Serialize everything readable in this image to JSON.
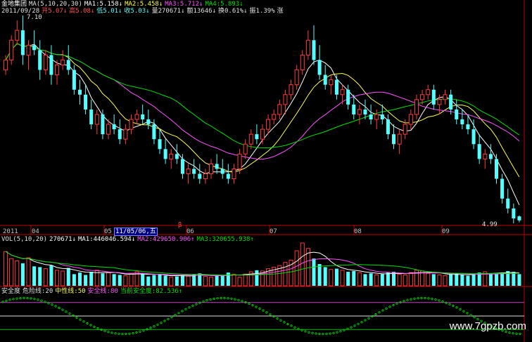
{
  "colors": {
    "up": "#ff3c3c",
    "down": "#54ffff",
    "ma1": "#ffffff",
    "ma2": "#ffff54",
    "ma3": "#ff54ff",
    "ma4": "#00e000",
    "grid": "#c00000",
    "safety_line": "#c040c0",
    "neutral_line": "#e0e0e0",
    "danger_line": "#00c000",
    "dot_curve": "#00e000"
  },
  "price_header": {
    "stock_name": "金地集团",
    "ma_label": "MA(5,10,20,30)",
    "ma1": "MA1:5.158↓",
    "ma2": "MA2:5.458↓",
    "ma3": "MA3:5.712↓",
    "ma4": "MA4:5.893↓"
  },
  "quote": {
    "date": "2011/09/28",
    "open": "开5.07↓",
    "high": "高5.08↓",
    "low": "低5.01↓",
    "close": "收5.03↓",
    "volume": "量270671↓",
    "amount": "额13646↓",
    "turnover": "换0.61%↓",
    "amplitude": "振1.39%",
    "change": "涨"
  },
  "price_labels": {
    "high_mark": "7.10",
    "low_mark": "4.99"
  },
  "x_axis": {
    "labels": [
      "2011",
      "04",
      "05",
      "06",
      "07",
      "08",
      "09"
    ],
    "cursor_date": "11/05/06,五",
    "event_marker": "β"
  },
  "volume_header": {
    "label": "VOL(5,10,20)",
    "vol": "270671↓",
    "ma1": "MA1:446046.594↓",
    "ma2": "MA2:429650.906↑",
    "ma3": "MA3:320655.938↑"
  },
  "safety_header": {
    "label": "安全度",
    "danger": "危险线:20",
    "neutral": "中性线:50",
    "safe": "安全线:80",
    "current": "当前安全度:82.536↑"
  },
  "watermark": "www.7gpzb.com",
  "chart_data": {
    "type": "candlestick",
    "series_ma_names": [
      "MA1",
      "MA2",
      "MA3",
      "MA4"
    ],
    "ylim": [
      4.99,
      7.1
    ],
    "candles": [
      [
        6.55,
        6.7,
        6.5,
        6.65
      ],
      [
        6.65,
        6.9,
        6.6,
        6.85
      ],
      [
        6.85,
        7.05,
        6.8,
        6.95
      ],
      [
        6.95,
        7.1,
        6.6,
        6.7
      ],
      [
        6.7,
        6.85,
        6.55,
        6.8
      ],
      [
        6.8,
        6.95,
        6.7,
        6.75
      ],
      [
        6.75,
        6.85,
        6.45,
        6.55
      ],
      [
        6.55,
        6.75,
        6.5,
        6.7
      ],
      [
        6.7,
        6.8,
        6.4,
        6.5
      ],
      [
        6.5,
        6.65,
        6.4,
        6.6
      ],
      [
        6.6,
        6.75,
        6.55,
        6.65
      ],
      [
        6.65,
        6.8,
        6.5,
        6.55
      ],
      [
        6.55,
        6.6,
        6.3,
        6.35
      ],
      [
        6.35,
        6.45,
        6.2,
        6.3
      ],
      [
        6.3,
        6.4,
        6.1,
        6.15
      ],
      [
        6.15,
        6.25,
        5.95,
        6.0
      ],
      [
        6.0,
        6.15,
        5.9,
        6.1
      ],
      [
        6.1,
        6.15,
        5.85,
        5.9
      ],
      [
        5.9,
        6.05,
        5.85,
        6.0
      ],
      [
        6.0,
        6.1,
        5.9,
        5.95
      ],
      [
        5.95,
        6.05,
        5.8,
        5.85
      ],
      [
        5.85,
        6.0,
        5.8,
        5.95
      ],
      [
        5.95,
        6.1,
        5.9,
        6.05
      ],
      [
        6.05,
        6.15,
        6.0,
        6.1
      ],
      [
        6.1,
        6.2,
        6.0,
        6.05
      ],
      [
        6.05,
        6.15,
        5.95,
        6.0
      ],
      [
        6.0,
        6.05,
        5.8,
        5.85
      ],
      [
        5.85,
        5.95,
        5.7,
        5.75
      ],
      [
        5.75,
        5.85,
        5.6,
        5.65
      ],
      [
        5.65,
        5.75,
        5.55,
        5.7
      ],
      [
        5.7,
        5.8,
        5.6,
        5.65
      ],
      [
        5.65,
        5.7,
        5.45,
        5.5
      ],
      [
        5.5,
        5.6,
        5.4,
        5.55
      ],
      [
        5.55,
        5.65,
        5.45,
        5.5
      ],
      [
        5.5,
        5.6,
        5.4,
        5.45
      ],
      [
        5.45,
        5.55,
        5.4,
        5.5
      ],
      [
        5.5,
        5.65,
        5.45,
        5.6
      ],
      [
        5.6,
        5.7,
        5.5,
        5.55
      ],
      [
        5.55,
        5.65,
        5.45,
        5.5
      ],
      [
        5.5,
        5.6,
        5.4,
        5.45
      ],
      [
        5.45,
        5.6,
        5.4,
        5.55
      ],
      [
        5.55,
        5.75,
        5.5,
        5.7
      ],
      [
        5.7,
        5.85,
        5.65,
        5.8
      ],
      [
        5.8,
        5.95,
        5.75,
        5.9
      ],
      [
        5.9,
        6.0,
        5.8,
        5.85
      ],
      [
        5.85,
        6.0,
        5.8,
        5.95
      ],
      [
        5.95,
        6.1,
        5.9,
        6.05
      ],
      [
        6.05,
        6.15,
        6.0,
        6.1
      ],
      [
        6.1,
        6.25,
        6.05,
        6.2
      ],
      [
        6.2,
        6.35,
        6.1,
        6.3
      ],
      [
        6.3,
        6.45,
        6.25,
        6.4
      ],
      [
        6.4,
        6.6,
        6.35,
        6.55
      ],
      [
        6.55,
        6.75,
        6.5,
        6.7
      ],
      [
        6.7,
        6.95,
        6.65,
        6.85
      ],
      [
        6.85,
        7.0,
        6.6,
        6.65
      ],
      [
        6.65,
        6.8,
        6.45,
        6.5
      ],
      [
        6.5,
        6.6,
        6.35,
        6.4
      ],
      [
        6.4,
        6.5,
        6.3,
        6.45
      ],
      [
        6.45,
        6.5,
        6.25,
        6.3
      ],
      [
        6.3,
        6.4,
        6.2,
        6.35
      ],
      [
        6.35,
        6.4,
        6.15,
        6.2
      ],
      [
        6.2,
        6.3,
        6.05,
        6.1
      ],
      [
        6.1,
        6.2,
        6.0,
        6.15
      ],
      [
        6.15,
        6.25,
        6.05,
        6.1
      ],
      [
        6.1,
        6.2,
        6.0,
        6.05
      ],
      [
        6.05,
        6.15,
        5.95,
        6.1
      ],
      [
        6.1,
        6.2,
        6.0,
        6.05
      ],
      [
        6.05,
        6.1,
        5.85,
        5.9
      ],
      [
        5.9,
        6.0,
        5.75,
        5.8
      ],
      [
        5.8,
        5.95,
        5.7,
        5.9
      ],
      [
        5.9,
        6.05,
        5.85,
        6.0
      ],
      [
        6.0,
        6.15,
        5.95,
        6.1
      ],
      [
        6.1,
        6.3,
        6.05,
        6.25
      ],
      [
        6.25,
        6.35,
        6.2,
        6.3
      ],
      [
        6.3,
        6.4,
        6.25,
        6.35
      ],
      [
        6.35,
        6.4,
        6.15,
        6.2
      ],
      [
        6.2,
        6.3,
        6.1,
        6.25
      ],
      [
        6.25,
        6.35,
        6.2,
        6.3
      ],
      [
        6.3,
        6.35,
        6.1,
        6.15
      ],
      [
        6.15,
        6.25,
        6.0,
        6.05
      ],
      [
        6.05,
        6.15,
        5.95,
        6.0
      ],
      [
        6.0,
        6.1,
        5.9,
        5.95
      ],
      [
        5.95,
        6.05,
        5.75,
        5.8
      ],
      [
        5.8,
        5.9,
        5.6,
        5.65
      ],
      [
        5.65,
        5.75,
        5.55,
        5.7
      ],
      [
        5.7,
        5.8,
        5.6,
        5.65
      ],
      [
        5.65,
        5.7,
        5.4,
        5.45
      ],
      [
        5.45,
        5.5,
        5.2,
        5.25
      ],
      [
        5.25,
        5.35,
        5.1,
        5.15
      ],
      [
        5.15,
        5.2,
        5.0,
        5.05
      ],
      [
        5.07,
        5.08,
        5.01,
        5.03
      ]
    ],
    "volume": [
      88,
      70,
      64,
      58,
      72,
      50,
      48,
      44,
      52,
      40,
      38,
      46,
      30,
      34,
      28,
      36,
      40,
      32,
      34,
      30,
      28,
      26,
      32,
      36,
      30,
      24,
      28,
      30,
      26,
      22,
      24,
      28,
      26,
      30,
      32,
      24,
      22,
      26,
      28,
      34,
      30,
      22,
      30,
      36,
      40,
      38,
      44,
      48,
      52,
      60,
      66,
      90,
      110,
      96,
      70,
      56,
      48,
      42,
      44,
      40,
      36,
      38,
      34,
      30,
      32,
      28,
      30,
      34,
      36,
      30,
      28,
      34,
      40,
      38,
      32,
      30,
      28,
      26,
      30,
      32,
      28,
      26,
      30,
      34,
      36,
      32,
      30,
      34,
      38,
      36,
      30
    ],
    "safety_index": {
      "danger": 20,
      "neutral": 50,
      "safe": 80,
      "current": 82.536
    }
  }
}
